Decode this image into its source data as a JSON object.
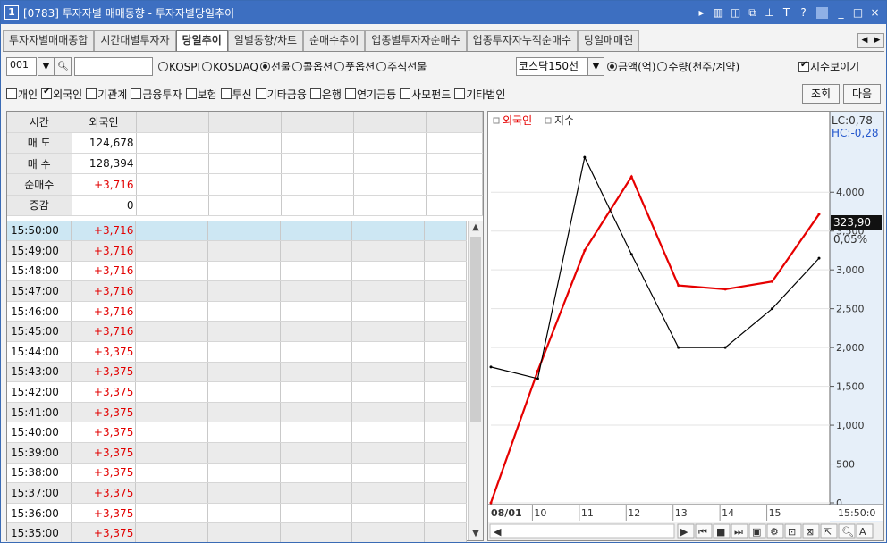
{
  "window": {
    "number": "1",
    "title": "[0783] 투자자별 매매동향 - 투자자별당일추이"
  },
  "title_icons": [
    "play-icon",
    "memo-icon",
    "split-icon",
    "copy-icon",
    "pin-icon",
    "font-icon",
    "help-icon",
    "minimize-icon",
    "maximize-icon",
    "close-icon"
  ],
  "title_glyphs": [
    "▸",
    "▥",
    "◫",
    "⧉",
    "⊥",
    "T",
    "?",
    "_",
    "□",
    "×"
  ],
  "tabs": [
    "투자자별매매종합",
    "시간대별투자자",
    "당일추이",
    "일별동향/차트",
    "순매수추이",
    "업종별투자자순매수",
    "업종투자자누적순매수",
    "당일매매현"
  ],
  "toolbar": {
    "code": "001",
    "markets": [
      "KOSPI",
      "KOSDAQ",
      "선물",
      "콜옵션",
      "풋옵션",
      "주식선물"
    ],
    "selected_market": "선물",
    "product": "코스닥150선",
    "units": [
      "금액(억)",
      "수량(천주/계약)"
    ],
    "selected_unit": "금액(억)",
    "show_index": "지수보이기"
  },
  "investors": [
    {
      "label": "개인",
      "checked": false
    },
    {
      "label": "외국인",
      "checked": true
    },
    {
      "label": "기관계",
      "checked": false
    },
    {
      "label": "금융투자",
      "checked": false
    },
    {
      "label": "보험",
      "checked": false
    },
    {
      "label": "투신",
      "checked": false
    },
    {
      "label": "기타금융",
      "checked": false
    },
    {
      "label": "은행",
      "checked": false
    },
    {
      "label": "연기금등",
      "checked": false
    },
    {
      "label": "사모펀드",
      "checked": false
    },
    {
      "label": "기타법인",
      "checked": false
    }
  ],
  "buttons": {
    "query": "조회",
    "next": "다음"
  },
  "summary": {
    "headers": [
      "시간",
      "외국인"
    ],
    "rows": [
      {
        "label": "매 도",
        "value": "124,678"
      },
      {
        "label": "매 수",
        "value": "128,394"
      },
      {
        "label": "순매수",
        "value": "+3,716"
      },
      {
        "label": "증감",
        "value": "0"
      }
    ]
  },
  "time_rows": [
    {
      "time": "15:50:00",
      "value": "+3,716"
    },
    {
      "time": "15:49:00",
      "value": "+3,716"
    },
    {
      "time": "15:48:00",
      "value": "+3,716"
    },
    {
      "time": "15:47:00",
      "value": "+3,716"
    },
    {
      "time": "15:46:00",
      "value": "+3,716"
    },
    {
      "time": "15:45:00",
      "value": "+3,716"
    },
    {
      "time": "15:44:00",
      "value": "+3,375"
    },
    {
      "time": "15:43:00",
      "value": "+3,375"
    },
    {
      "time": "15:42:00",
      "value": "+3,375"
    },
    {
      "time": "15:41:00",
      "value": "+3,375"
    },
    {
      "time": "15:40:00",
      "value": "+3,375"
    },
    {
      "time": "15:39:00",
      "value": "+3,375"
    },
    {
      "time": "15:38:00",
      "value": "+3,375"
    },
    {
      "time": "15:37:00",
      "value": "+3,375"
    },
    {
      "time": "15:36:00",
      "value": "+3,375"
    },
    {
      "time": "15:35:00",
      "value": "+3,375"
    }
  ],
  "chart": {
    "legend": [
      "외국인",
      "지수"
    ],
    "lc": "LC:0,78",
    "hc": "HC:-0,28",
    "price_tag": "323,90",
    "pct_tag": "0,05%",
    "date": "08/01",
    "x_ticks": [
      "10",
      "11",
      "12",
      "13",
      "14",
      "15"
    ],
    "time_label": "15:50:0",
    "y_ticks": [
      "4,000",
      "3,500",
      "3,000",
      "2,500",
      "2,000",
      "1,500",
      "1,000",
      "500",
      "0"
    ],
    "colors": {
      "foreign": "#e60000",
      "index": "#000000"
    }
  },
  "chart_data": {
    "type": "line",
    "categories": [
      "09:00",
      "10:00",
      "11:00",
      "12:00",
      "13:00",
      "14:00",
      "15:00",
      "15:50"
    ],
    "series": [
      {
        "name": "외국인",
        "values": [
          0,
          1700,
          3250,
          4200,
          2800,
          2750,
          2850,
          3716
        ]
      },
      {
        "name": "지수",
        "values": [
          1750,
          1600,
          4450,
          3200,
          2000,
          2000,
          2500,
          3150
        ]
      }
    ],
    "y_ticks": [
      "4,000",
      "3,500",
      "3,000",
      "2,500",
      "2,000",
      "1,500",
      "1,000",
      "500",
      "0"
    ],
    "ylim": [
      0,
      4900
    ],
    "grid": true,
    "legend_position": "top-left"
  }
}
